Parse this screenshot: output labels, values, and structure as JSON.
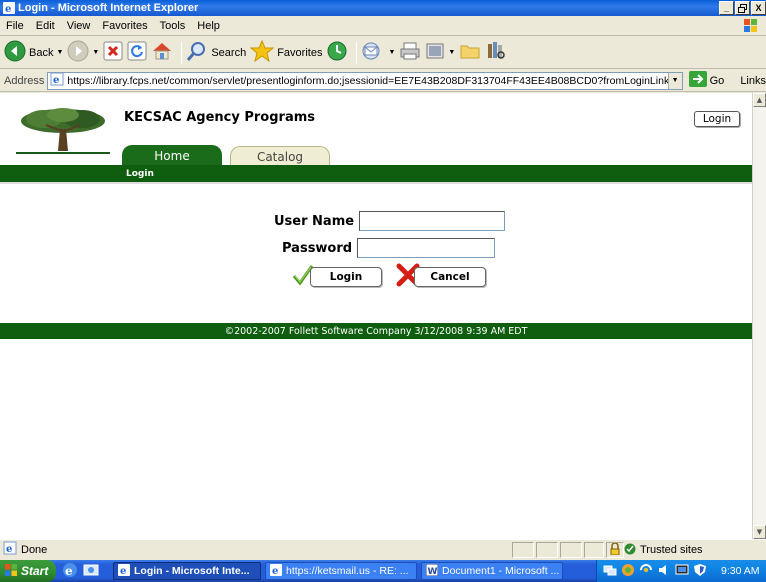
{
  "window": {
    "title": "Login - Microsoft Internet Explorer",
    "buttons": [
      "_",
      "²",
      "X"
    ]
  },
  "menu": [
    "File",
    "Edit",
    "View",
    "Favorites",
    "Tools",
    "Help"
  ],
  "toolbar": {
    "back": "Back",
    "search": "Search",
    "favorites": "Favorites"
  },
  "address": {
    "label": "Address",
    "url": "https://library.fcps.net/common/servlet/presentloginform.do;jsessionid=EE7E43B208DF313704FF43EE4B08BCD0?fromLoginLink=",
    "go": "Go",
    "links": "Links"
  },
  "page": {
    "agency": "KECSAC Agency Programs",
    "login_top": "Login",
    "tabs": [
      "Home",
      "Catalog"
    ],
    "subnav": "Login",
    "username_label": "User Name",
    "password_label": "Password",
    "login_button": "Login",
    "cancel_button": "Cancel",
    "footer": "©2002-2007  Follett Software Company    3/12/2008 9:39 AM EDT"
  },
  "status": {
    "text": "Done",
    "zone": "Trusted sites"
  },
  "taskbar": {
    "start": "Start",
    "tasks": [
      "Login - Microsoft Inte...",
      "https://ketsmail.us - RE: ...",
      "Document1 - Microsoft ..."
    ],
    "clock": "9:30 AM"
  }
}
